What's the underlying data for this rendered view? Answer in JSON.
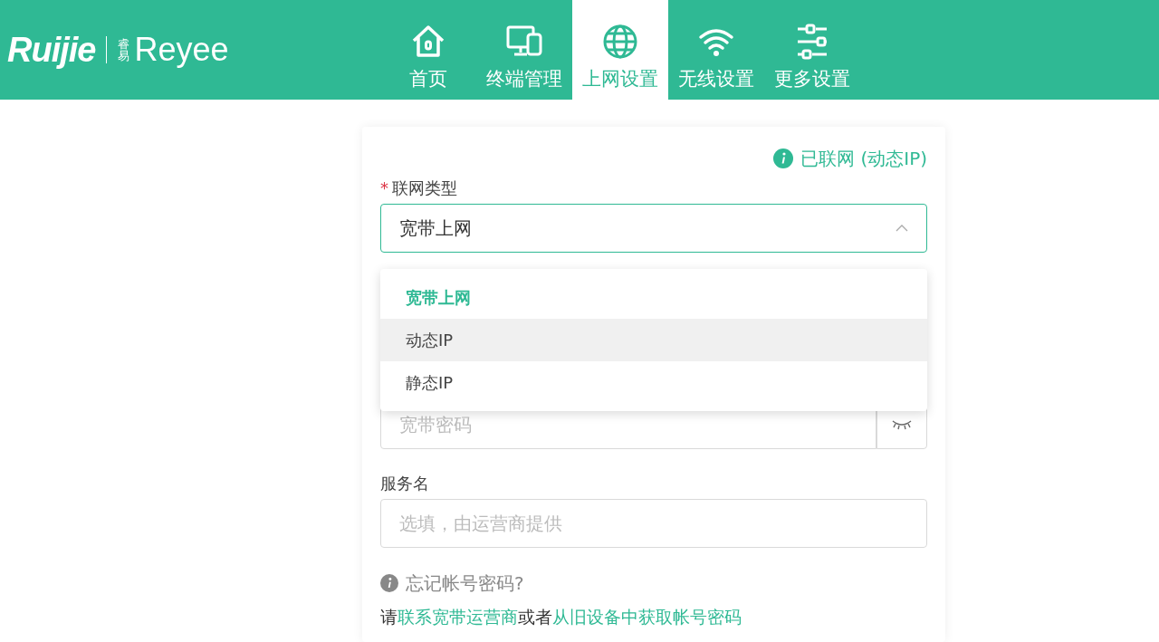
{
  "logo": {
    "brand": "Ruijie",
    "sub_mark": "睿易",
    "sub": "Reyee"
  },
  "nav": [
    {
      "label": "首页",
      "selected": false
    },
    {
      "label": "终端管理",
      "selected": false
    },
    {
      "label": "上网设置",
      "selected": true
    },
    {
      "label": "无线设置",
      "selected": false
    },
    {
      "label": "更多设置",
      "selected": false
    }
  ],
  "status": "已联网 (动态IP)",
  "connection_type": {
    "label": "联网类型",
    "required_mark": "*",
    "value": "宽带上网",
    "expanded": true
  },
  "dropdown": [
    {
      "label": "宽带上网",
      "kind": "group",
      "selected": true
    },
    {
      "label": "动态IP",
      "kind": "option",
      "selected": false,
      "hovered": true
    },
    {
      "label": "静态IP",
      "kind": "option",
      "selected": false,
      "hovered": false
    }
  ],
  "password": {
    "placeholder": "宽带密码"
  },
  "service": {
    "label": "服务名",
    "placeholder": "选填，由运营商提供"
  },
  "help": {
    "title": "忘记帐号密码?",
    "text": [
      {
        "kind": "text",
        "text": "请"
      },
      {
        "kind": "link",
        "text": "联系宽带运营商"
      },
      {
        "kind": "text",
        "text": "或者"
      },
      {
        "kind": "link",
        "text": "从旧设备中获取帐号密码"
      }
    ]
  }
}
